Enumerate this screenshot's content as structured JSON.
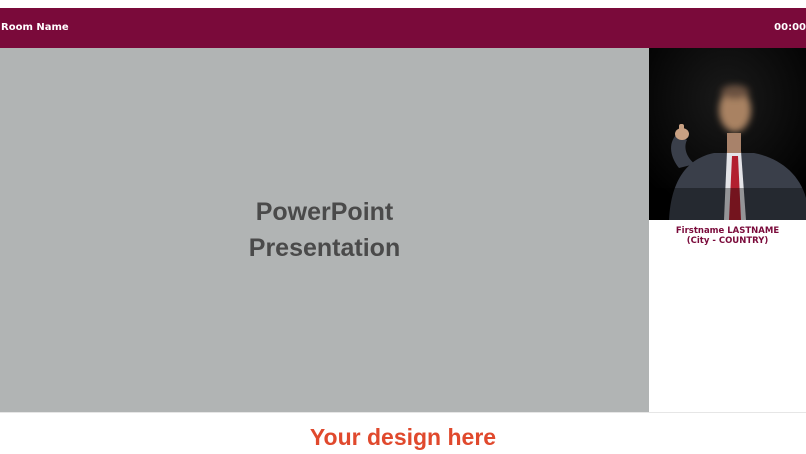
{
  "header": {
    "room_name": "Room Name",
    "timer": "00:00"
  },
  "slide": {
    "line1": "PowerPoint",
    "line2": "Presentation"
  },
  "speaker": {
    "name": "Firstname LASTNAME",
    "location": "(City - COUNTRY)"
  },
  "footer": {
    "design_text": "Your design here"
  },
  "colors": {
    "header_bg": "#7a0a3a",
    "slide_bg": "#b1b4b4",
    "speaker_text": "#7a0a3a",
    "design_text": "#e0492d"
  }
}
